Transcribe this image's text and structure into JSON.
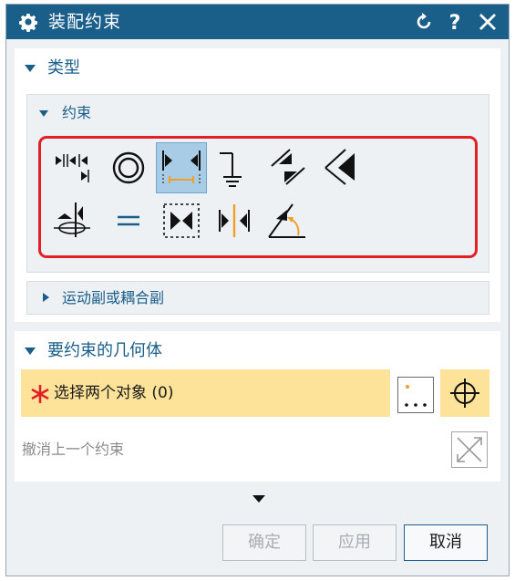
{
  "window": {
    "title": "装配约束",
    "reset_icon": "reset-icon",
    "help_label": "?",
    "close_icon": "close-icon"
  },
  "type_section": {
    "label": "类型",
    "constraint_group": {
      "label": "约束",
      "icons": [
        {
          "name": "touch-align-icon"
        },
        {
          "name": "concentric-icon"
        },
        {
          "name": "distance-icon",
          "selected": true
        },
        {
          "name": "fix-icon"
        },
        {
          "name": "parallel-icon"
        },
        {
          "name": "perpendicular-icon"
        },
        {
          "name": "align-lock-icon"
        },
        {
          "name": "equal-fit-icon"
        },
        {
          "name": "bond-icon"
        },
        {
          "name": "center-icon"
        },
        {
          "name": "angle-icon"
        }
      ]
    },
    "motion_group": {
      "label": "运动副或耦合副"
    }
  },
  "geometry_section": {
    "label": "要约束的几何体",
    "select_label": "选择两个对象 (0)",
    "undo_label": "撤消上一个约束"
  },
  "footer": {
    "ok_label": "确定",
    "apply_label": "应用",
    "cancel_label": "取消"
  },
  "colors": {
    "titlebar": "#1a5e8a",
    "accent": "#1a5e8a",
    "highlight_red": "#e21f26",
    "selection_yellow": "#fde29a",
    "selected_icon_bg": "#a8cce6",
    "orange": "#f0a028"
  }
}
